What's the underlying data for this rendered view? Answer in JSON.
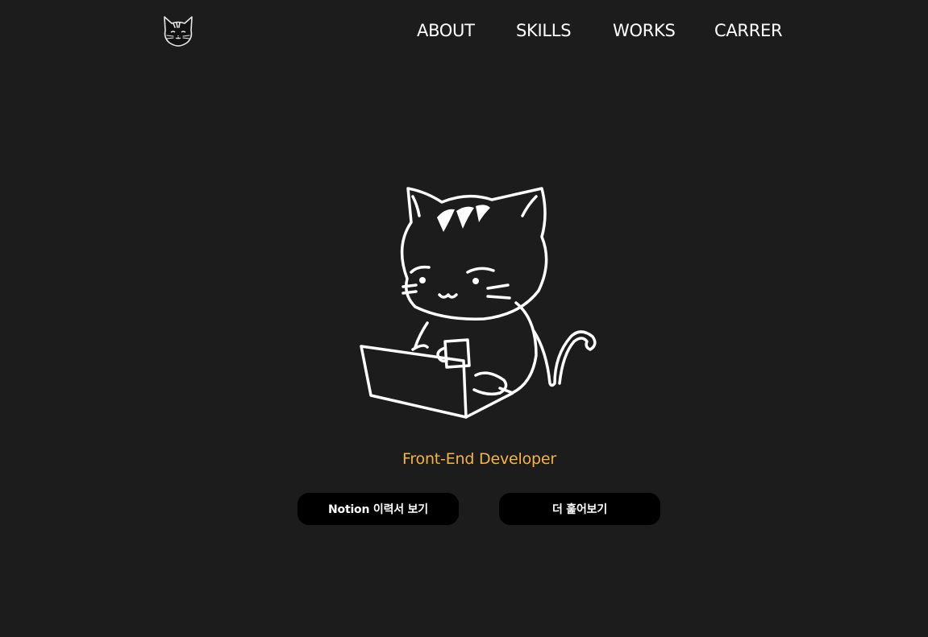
{
  "header": {
    "logo_icon": "cat-face-logo-icon",
    "nav": [
      {
        "label": "ABOUT"
      },
      {
        "label": "SKILLS"
      },
      {
        "label": "WORKS"
      },
      {
        "label": "CARRER"
      }
    ]
  },
  "hero": {
    "illustration_icon": "cat-with-laptop-illustration",
    "subtitle": "Front-End Developer",
    "buttons": {
      "notion_label": "Notion 이력서 보기",
      "more_label": "더 훑어보기"
    }
  },
  "colors": {
    "background": "#1c1c1c",
    "accent": "#f4b63f",
    "button_bg": "#000000",
    "text": "#ffffff"
  }
}
